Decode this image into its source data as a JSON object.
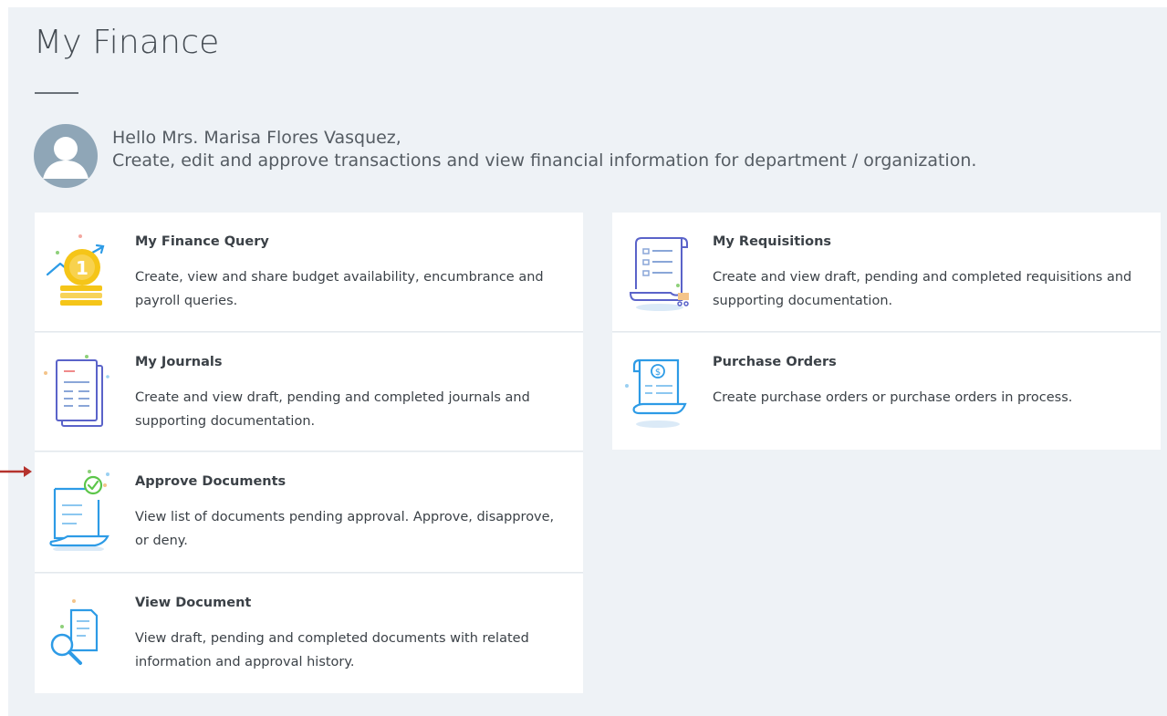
{
  "header": {
    "title": "My Finance",
    "greeting_line1": "Hello Mrs. Marisa Flores Vasquez,",
    "greeting_line2": "Create, edit and approve transactions and view financial information for department / organization."
  },
  "cards": {
    "finance_query": {
      "title": "My Finance Query",
      "description": "Create, view and share budget availability, encumbrance and payroll queries.",
      "icon": "coin-stack-icon"
    },
    "journals": {
      "title": "My Journals",
      "description": "Create and view draft, pending and completed journals and supporting documentation.",
      "icon": "journal-icon"
    },
    "approve_documents": {
      "title": "Approve Documents",
      "description": "View list of documents pending approval. Approve, disapprove, or deny.",
      "icon": "approve-document-icon"
    },
    "view_document": {
      "title": "View Document",
      "description": "View draft, pending and completed documents with related information and approval history.",
      "icon": "document-search-icon"
    },
    "requisitions": {
      "title": "My Requisitions",
      "description": "Create and view draft, pending and completed requisitions and supporting documentation.",
      "icon": "requisition-icon"
    },
    "purchase_orders": {
      "title": "Purchase Orders",
      "description": "Create purchase orders or purchase orders in process.",
      "icon": "purchase-order-icon"
    }
  },
  "colors": {
    "background_panel": "#eef2f6",
    "card": "#ffffff",
    "accent_blue": "#2d9be6",
    "accent_yellow": "#f5c518",
    "accent_green": "#5cc64a",
    "arrow_red": "#b5332d"
  }
}
